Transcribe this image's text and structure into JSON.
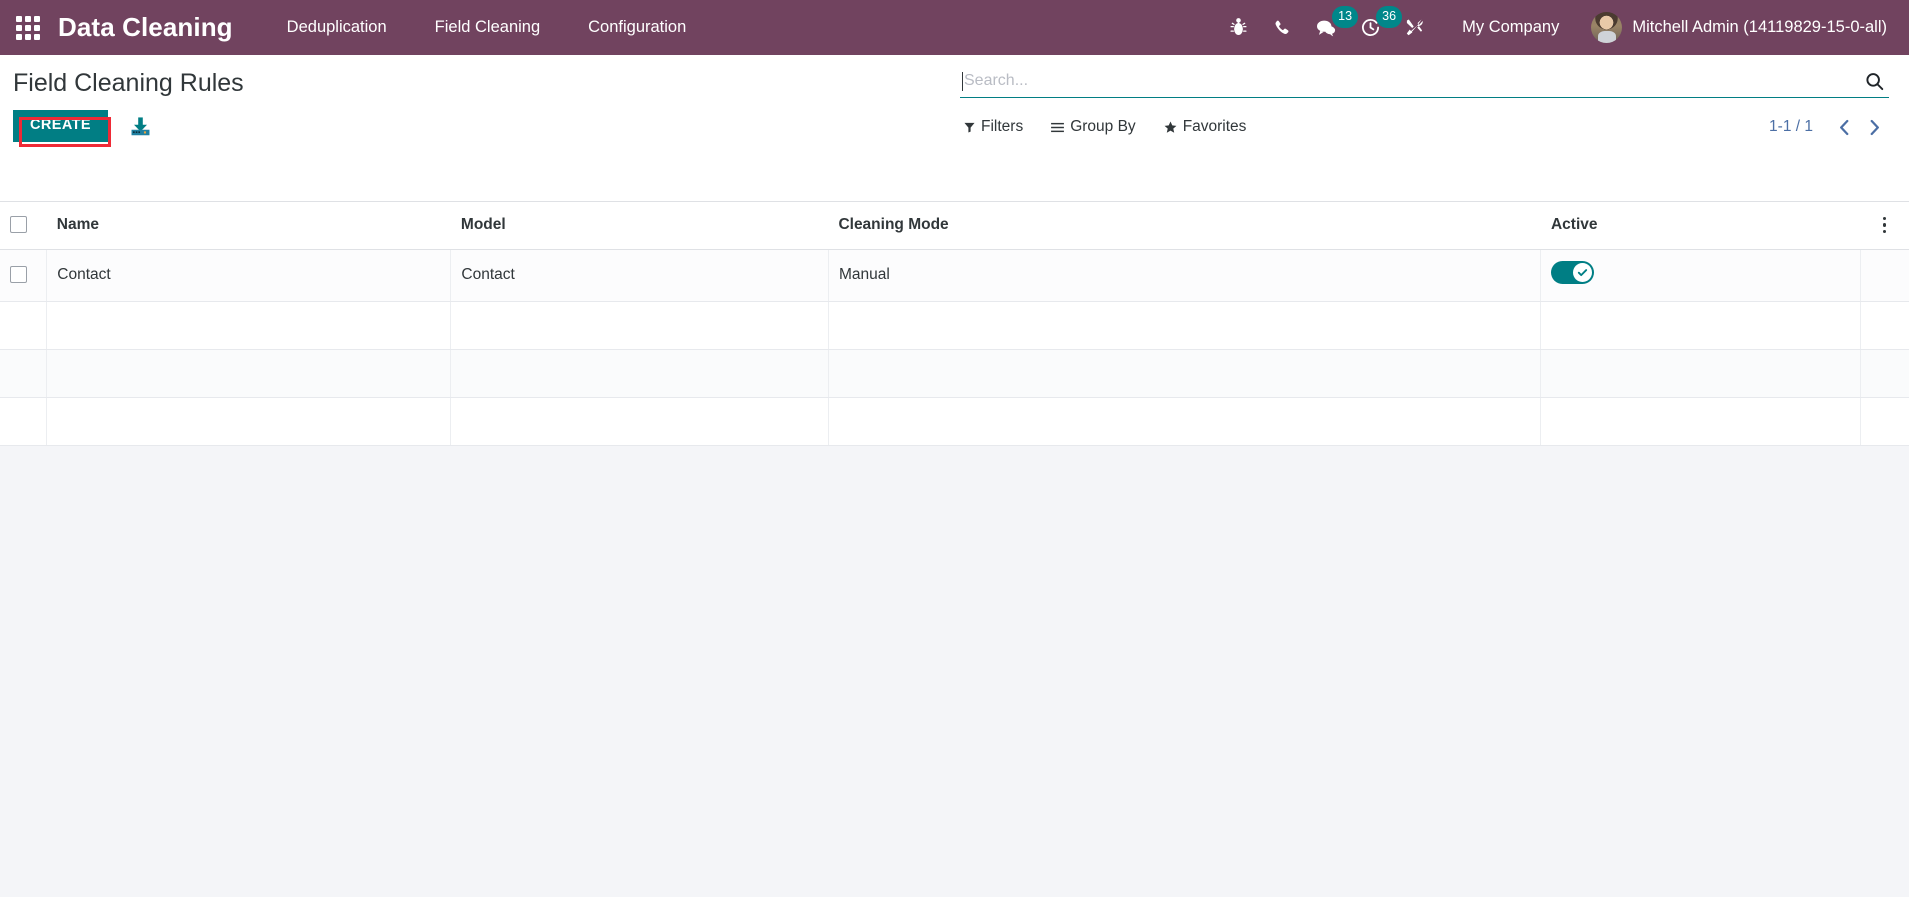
{
  "navbar": {
    "apps_icon": "apps-grid-icon",
    "brand": "Data Cleaning",
    "menu": [
      {
        "label": "Deduplication",
        "name": "menu-deduplication"
      },
      {
        "label": "Field Cleaning",
        "name": "menu-field-cleaning"
      },
      {
        "label": "Configuration",
        "name": "menu-configuration"
      }
    ],
    "icons": [
      {
        "name": "bug-icon",
        "badge": null
      },
      {
        "name": "phone-icon",
        "badge": null
      },
      {
        "name": "messages-icon",
        "badge": "13"
      },
      {
        "name": "activities-clock-icon",
        "badge": "36"
      },
      {
        "name": "tools-icon",
        "badge": null
      }
    ],
    "company": "My Company",
    "user_name": "Mitchell Admin (14119829-15-0-all)",
    "avatar": "user-avatar",
    "bg_color": "#71435f",
    "badge_color": "#00878a"
  },
  "control_panel": {
    "title": "Field Cleaning Rules",
    "create_label": "CREATE",
    "import_icon": "import-download-icon",
    "highlight_color": "#ef2a36",
    "accent_color": "#017e84",
    "search": {
      "value": "",
      "placeholder": "Search...",
      "icon": "search-icon"
    },
    "filters": [
      {
        "label": "Filters",
        "name": "filters-button",
        "icon": "funnel-icon"
      },
      {
        "label": "Group By",
        "name": "group-by-button",
        "icon": "bars-icon"
      },
      {
        "label": "Favorites",
        "name": "favorites-button",
        "icon": "star-icon"
      }
    ],
    "pager": {
      "count": "1-1 / 1",
      "prev": "‹",
      "next": "›"
    }
  },
  "list": {
    "columns": [
      {
        "label": "Name",
        "key": "name"
      },
      {
        "label": "Model",
        "key": "model"
      },
      {
        "label": "Cleaning Mode",
        "key": "cleaning_mode"
      },
      {
        "label": "Active",
        "key": "active"
      }
    ],
    "rows": [
      {
        "name": "Contact",
        "model": "Contact",
        "cleaning_mode": "Manual",
        "active": true
      }
    ],
    "empty_row_count": 3,
    "options_icon": "vertical-dots-icon",
    "toggle_on_color": "#007e84"
  }
}
